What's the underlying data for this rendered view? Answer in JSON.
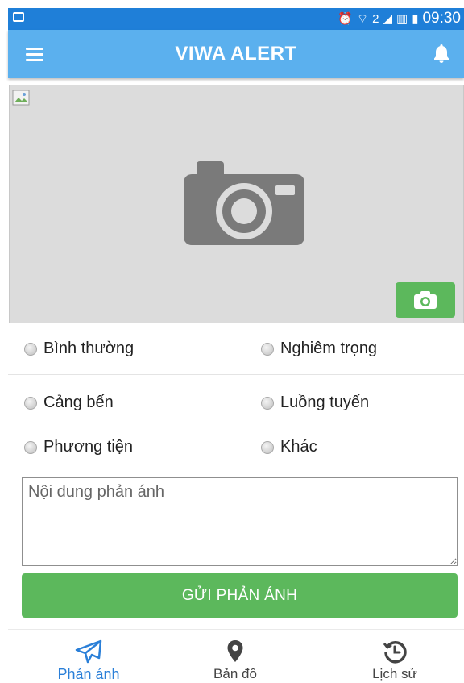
{
  "status_bar": {
    "time": "09:30",
    "sim_slot": "2"
  },
  "app_bar": {
    "title": "VIWA ALERT"
  },
  "severity": {
    "options": [
      "Bình thường",
      "Nghiêm trọng"
    ]
  },
  "category": {
    "options": [
      "Cảng bến",
      "Luồng tuyến",
      "Phương tiện",
      "Khác"
    ]
  },
  "content": {
    "placeholder": "Nội dung phản ánh",
    "value": ""
  },
  "submit": {
    "label": "GỬI PHẢN ÁNH"
  },
  "bottom_nav": {
    "items": [
      {
        "label": "Phản ánh",
        "icon": "send-icon",
        "active": true
      },
      {
        "label": "Bản đồ",
        "icon": "map-pin-icon",
        "active": false
      },
      {
        "label": "Lịch sử",
        "icon": "history-icon",
        "active": false
      }
    ]
  },
  "colors": {
    "status_bar": "#1f7fd8",
    "app_bar": "#5bb0ee",
    "accent_green": "#5cb85c",
    "nav_active": "#2a7fd8"
  }
}
